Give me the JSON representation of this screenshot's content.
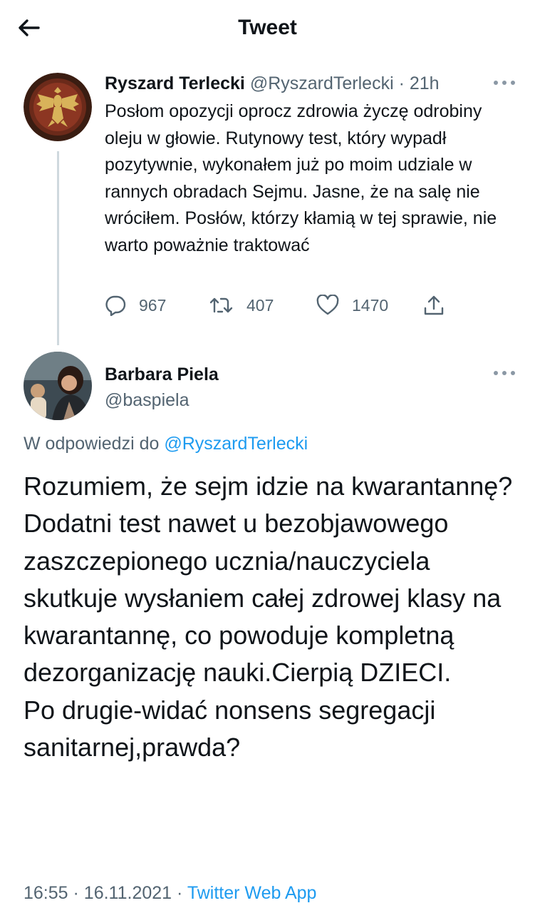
{
  "header": {
    "title": "Tweet",
    "back_icon": "arrow-left-icon"
  },
  "original_tweet": {
    "author_name": "Ryszard Terlecki",
    "author_handle": "@RyszardTerlecki",
    "separator": "·",
    "time_ago": "21h",
    "text": "Posłom opozycji oprocz zdrowia życzę odrobiny oleju w głowie. Rutynowy test, który wypadł pozytywnie, wykonałem już po moim udziale w rannych obradach Sejmu. Jasne, że na salę nie wróciłem. Posłów, którzy kłamią w tej sprawie, nie warto poważnie traktować",
    "replies": "967",
    "retweets": "407",
    "likes": "1470"
  },
  "reply_tweet": {
    "author_name": "Barbara Piela",
    "author_handle": "@baspiela",
    "reply_prefix": "W odpowiedzi do",
    "reply_to_handle": "@RyszardTerlecki",
    "text": "Rozumiem, że sejm idzie na kwarantannę?\nDodatni test nawet u bezobjawowego zaszczepionego ucznia/nauczyciela skutkuje wysłaniem całej zdrowej klasy na kwarantannę, co powoduje kompletną dezorganizację nauki.Cierpią DZIECI.\nPo drugie-widać nonsens segregacji sanitarnej,prawda?",
    "time": "16:55",
    "separator": "·",
    "date": "16.11.2021",
    "source": "Twitter Web App"
  },
  "colors": {
    "text": "#0f1419",
    "secondary": "#536471",
    "accent": "#1d9bf0",
    "thread_line": "#cfd9de"
  }
}
